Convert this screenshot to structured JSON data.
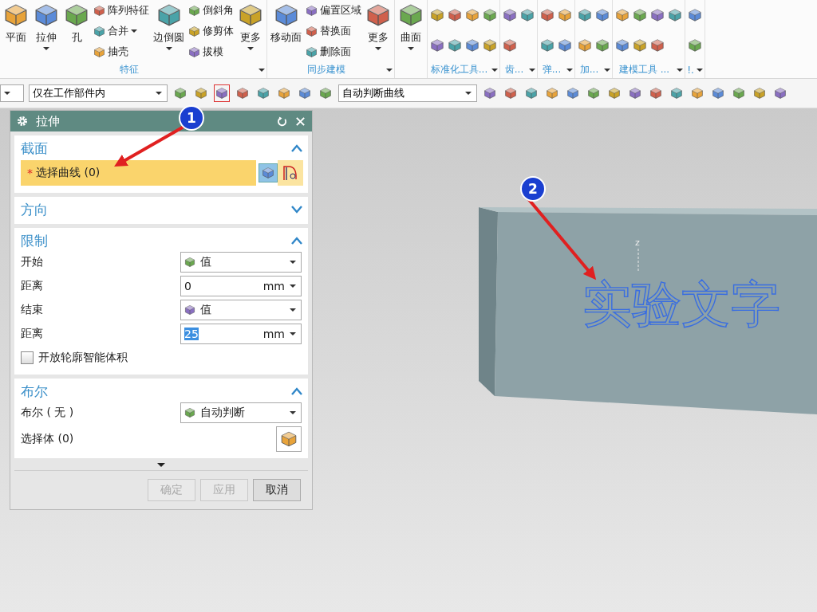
{
  "ribbon": {
    "groups": [
      {
        "label": "特征",
        "launcher": true,
        "tools": [
          {
            "kind": "large",
            "label": "平面",
            "menu": false
          },
          {
            "kind": "large",
            "label": "拉伸",
            "menu": true
          },
          {
            "kind": "large",
            "label": "孔",
            "menu": false
          },
          {
            "kind": "small",
            "label": "阵列特征",
            "menu": false
          },
          {
            "kind": "small",
            "label": "合并",
            "menu": true
          },
          {
            "kind": "small",
            "label": "抽壳",
            "menu": false
          },
          {
            "kind": "large",
            "label": "边倒圆",
            "menu": true
          },
          {
            "kind": "small",
            "label": "倒斜角",
            "menu": false
          },
          {
            "kind": "small",
            "label": "修剪体",
            "menu": false
          },
          {
            "kind": "small",
            "label": "拔模",
            "menu": false
          },
          {
            "kind": "large",
            "label": "更多",
            "menu": true
          }
        ]
      },
      {
        "label": "同步建模",
        "launcher": true,
        "tools": [
          {
            "kind": "large",
            "label": "移动面",
            "menu": false
          },
          {
            "kind": "small",
            "label": "偏置区域",
            "menu": false
          },
          {
            "kind": "small",
            "label": "替换面",
            "menu": false
          },
          {
            "kind": "small",
            "label": "删除面",
            "menu": false
          },
          {
            "kind": "large",
            "label": "更多",
            "menu": true
          }
        ]
      },
      {
        "launcher": false,
        "tools": [
          {
            "kind": "large",
            "label": "曲面",
            "menu": true
          }
        ]
      },
      {
        "label": "标准化工具...",
        "launcher": true,
        "tools": [
          {
            "kind": "icon"
          },
          {
            "kind": "icon"
          },
          {
            "kind": "icon"
          },
          {
            "kind": "icon"
          },
          {
            "kind": "icon"
          },
          {
            "kind": "icon"
          },
          {
            "kind": "icon"
          },
          {
            "kind": "icon"
          }
        ]
      },
      {
        "label": "齿...",
        "launcher": true,
        "tools": [
          {
            "kind": "icon"
          },
          {
            "kind": "icon"
          },
          {
            "kind": "icon"
          }
        ]
      },
      {
        "label": "弹...",
        "launcher": true,
        "tools": [
          {
            "kind": "icon"
          },
          {
            "kind": "icon"
          },
          {
            "kind": "icon"
          },
          {
            "kind": "icon"
          }
        ]
      },
      {
        "label": "加...",
        "launcher": true,
        "tools": [
          {
            "kind": "icon"
          },
          {
            "kind": "icon"
          },
          {
            "kind": "icon"
          },
          {
            "kind": "icon"
          }
        ]
      },
      {
        "label": "建模工具 ...",
        "launcher": true,
        "tools": [
          {
            "kind": "icon"
          },
          {
            "kind": "icon"
          },
          {
            "kind": "icon"
          },
          {
            "kind": "icon"
          },
          {
            "kind": "icon"
          },
          {
            "kind": "icon"
          },
          {
            "kind": "icon"
          }
        ]
      },
      {
        "label": "!.",
        "launcher": true,
        "tools": [
          {
            "kind": "icon"
          },
          {
            "kind": "icon"
          }
        ]
      }
    ]
  },
  "toolbar": {
    "items": [
      {
        "kind": "dropdown"
      },
      {
        "kind": "dropdown",
        "value": "仅在工作部件内"
      },
      {
        "kind": "icon",
        "selected": false
      },
      {
        "kind": "icon",
        "selected": false
      },
      {
        "kind": "icon",
        "selected": true
      },
      {
        "kind": "icon",
        "selected": false
      },
      {
        "kind": "icon",
        "selected": false
      },
      {
        "kind": "icon",
        "selected": false
      },
      {
        "kind": "icon",
        "selected": false
      },
      {
        "kind": "icon",
        "selected": false
      },
      {
        "kind": "dropdown",
        "value": "自动判断曲线"
      },
      {
        "kind": "icon",
        "selected": false
      },
      {
        "kind": "icon",
        "selected": false
      },
      {
        "kind": "icon",
        "selected": false
      },
      {
        "kind": "icon",
        "selected": false
      },
      {
        "kind": "icon",
        "selected": false
      },
      {
        "kind": "icon",
        "selected": false
      },
      {
        "kind": "icon",
        "selected": false
      },
      {
        "kind": "icon",
        "selected": false
      },
      {
        "kind": "icon",
        "selected": false
      },
      {
        "kind": "icon",
        "selected": false
      },
      {
        "kind": "icon",
        "selected": false
      },
      {
        "kind": "icon",
        "selected": false
      },
      {
        "kind": "icon",
        "selected": false
      },
      {
        "kind": "icon",
        "selected": false
      },
      {
        "kind": "icon",
        "selected": false
      }
    ]
  },
  "dialog": {
    "title": "拉伸",
    "sections": [
      {
        "title": "截面",
        "expanded": true,
        "rows": [
          {
            "kind": "selection",
            "marker": "*",
            "label": "选择曲线 (0)"
          }
        ]
      },
      {
        "title": "方向",
        "expanded": false
      },
      {
        "title": "限制",
        "expanded": true,
        "rows": [
          {
            "kind": "dropdown",
            "label": "开始",
            "value": "值"
          },
          {
            "kind": "number",
            "label": "距离",
            "value": "0",
            "unit": "mm",
            "text_selected": false
          },
          {
            "kind": "dropdown",
            "label": "结束",
            "value": "值"
          },
          {
            "kind": "number",
            "label": "距离",
            "value": "25",
            "unit": "mm",
            "text_selected": true
          },
          {
            "kind": "checkbox",
            "label": "开放轮廓智能体积",
            "checked": false
          }
        ]
      },
      {
        "title": "布尔",
        "expanded": true,
        "rows": [
          {
            "kind": "dropdown",
            "label": "布尔 ( 无 )",
            "value": "自动判断"
          },
          {
            "kind": "picker",
            "label": "选择体 (0)"
          }
        ]
      }
    ],
    "buttons": [
      {
        "label": "确定",
        "disabled": true
      },
      {
        "label": "应用",
        "disabled": true
      },
      {
        "label": "取消",
        "disabled": false
      }
    ]
  },
  "model": {
    "text": "实验文字",
    "axis_label": "z"
  },
  "annotations": [
    {
      "label": "1"
    },
    {
      "label": "2"
    }
  ]
}
